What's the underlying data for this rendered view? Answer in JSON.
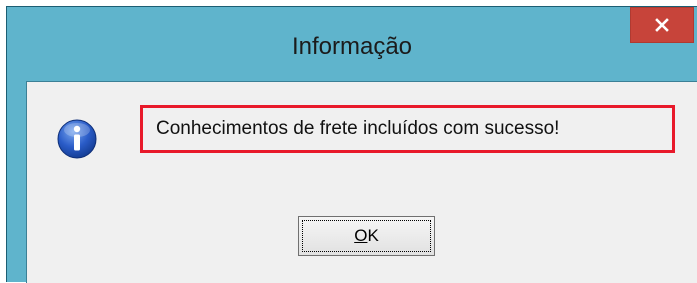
{
  "dialog": {
    "title": "Informação",
    "message": "Conhecimentos de frete incluídos com sucesso!",
    "ok_mnemonic": "O",
    "ok_rest": "K",
    "icon": "info-icon",
    "close_icon": "close-icon"
  },
  "colors": {
    "frame": "#5fb4cc",
    "close_button": "#c7443a",
    "highlight_border": "#e8192a",
    "client_background": "#f0f0f0"
  }
}
